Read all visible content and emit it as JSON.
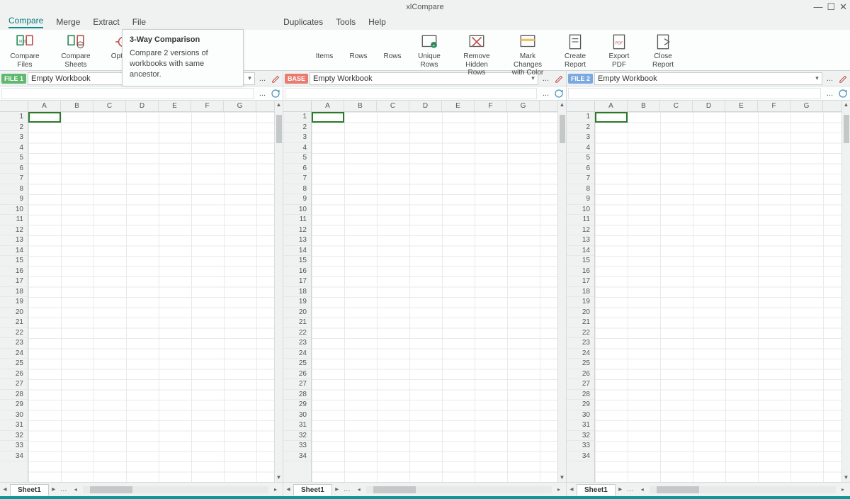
{
  "app_title": "xlCompare",
  "window_controls": {
    "min": "—",
    "max": "☐",
    "close": "✕"
  },
  "menu": [
    "Compare",
    "Merge",
    "Extract",
    "File",
    "Duplicates",
    "Tools",
    "Help"
  ],
  "menu_active": "Compare",
  "ribbon": {
    "compare_files": "Compare\nFiles",
    "compare_sheets": "Compare\nSheets",
    "options": "Options",
    "three_way": "3-Way",
    "items": "Items",
    "rows1": "Rows",
    "rows2": "Rows",
    "unique_rows": "Unique\nRows",
    "remove_hidden": "Remove\nHidden Rows",
    "mark_changes": "Mark Changes\nwith Color",
    "create_report": "Create\nReport",
    "export_pdf": "Export\nPDF",
    "close_report": "Close\nReport"
  },
  "tooltip": {
    "title": "3-Way Comparison",
    "body": "Compare 2 versions of workbooks with same ancestor."
  },
  "panels": [
    {
      "badge": "FILE 1",
      "badge_class": "file1",
      "workbook": "Empty Workbook",
      "sheet": "Sheet1"
    },
    {
      "badge": "BASE",
      "badge_class": "base",
      "workbook": "Empty Workbook",
      "sheet": "Sheet1"
    },
    {
      "badge": "FILE 2",
      "badge_class": "file2",
      "workbook": "Empty Workbook",
      "sheet": "Sheet1"
    }
  ],
  "columns": [
    "A",
    "B",
    "C",
    "D",
    "E",
    "F",
    "G"
  ],
  "row_count": 34,
  "dots": "..."
}
